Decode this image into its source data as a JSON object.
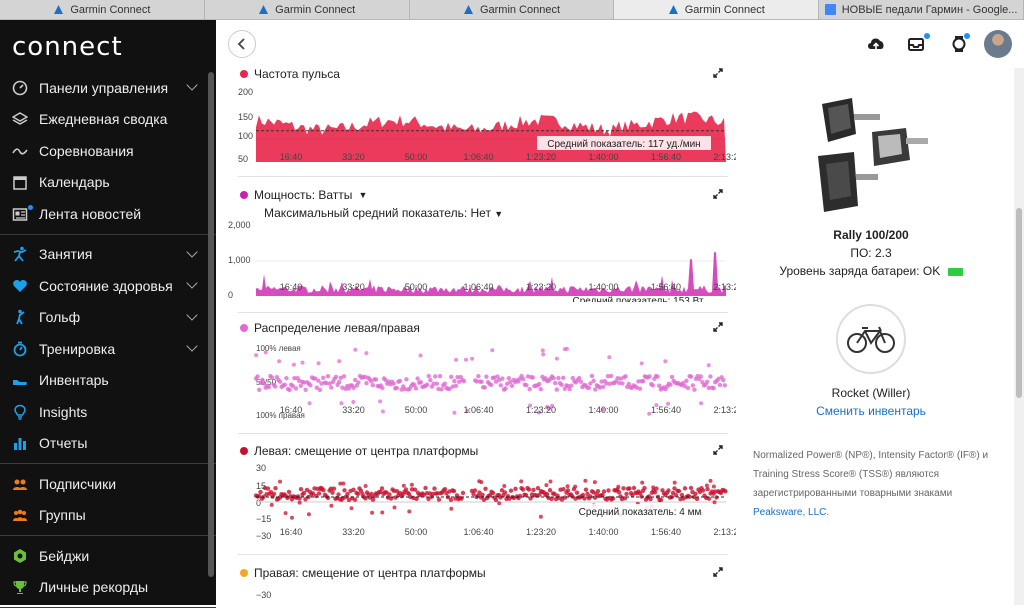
{
  "browser": {
    "tabs": [
      {
        "label": "Garmin Connect",
        "active": false,
        "icon": "garmin-triangle-icon"
      },
      {
        "label": "Garmin Connect",
        "active": false,
        "icon": "garmin-triangle-icon"
      },
      {
        "label": "Garmin Connect",
        "active": false,
        "icon": "garmin-triangle-icon"
      },
      {
        "label": "Garmin Connect",
        "active": true,
        "icon": "garmin-triangle-icon"
      },
      {
        "label": "НОВЫЕ педали Гармин - Google...",
        "active": false,
        "icon": "google-docs-icon"
      }
    ]
  },
  "app": {
    "logo": "connect"
  },
  "sidebar": {
    "groups": [
      [
        {
          "label": "Панели управления",
          "icon": "dashboard-gauge-icon",
          "chevron": true
        },
        {
          "label": "Ежедневная сводка",
          "icon": "layers-icon",
          "chevron": false
        },
        {
          "label": "Соревнования",
          "icon": "challenge-wave-icon",
          "chevron": false
        },
        {
          "label": "Календарь",
          "icon": "calendar-icon",
          "chevron": false
        },
        {
          "label": "Лента новостей",
          "icon": "newsfeed-icon",
          "chevron": false,
          "badge": true
        }
      ],
      [
        {
          "label": "Занятия",
          "icon": "running-person-icon",
          "chevron": true
        },
        {
          "label": "Состояние здоровья",
          "icon": "heart-icon",
          "chevron": true
        },
        {
          "label": "Гольф",
          "icon": "golfer-icon",
          "chevron": true
        },
        {
          "label": "Тренировка",
          "icon": "stopwatch-icon",
          "chevron": true
        },
        {
          "label": "Инвентарь",
          "icon": "shoe-icon",
          "chevron": false
        },
        {
          "label": "Insights",
          "icon": "lightbulb-icon",
          "chevron": false
        },
        {
          "label": "Отчеты",
          "icon": "bar-chart-icon",
          "chevron": false
        }
      ],
      [
        {
          "label": "Подписчики",
          "icon": "connections-icon",
          "chevron": false
        },
        {
          "label": "Группы",
          "icon": "groups-icon",
          "chevron": false
        }
      ],
      [
        {
          "label": "Бейджи",
          "icon": "badge-hexagon-icon",
          "chevron": false
        },
        {
          "label": "Личные рекорды",
          "icon": "trophy-icon",
          "chevron": false
        }
      ]
    ]
  },
  "header": {
    "icons": [
      "upload-cloud-icon",
      "inbox-icon",
      "watch-icon",
      "user-avatar"
    ]
  },
  "charts": {
    "heart_rate": {
      "title": "Частота пульса",
      "color": "#e8264b",
      "y_ticks": [
        "200",
        "150",
        "100",
        "50"
      ],
      "avg_label": "Средний показатель: 117 уд./мин"
    },
    "power": {
      "title": "Мощность: Ватты",
      "subtitle": "Максимальный средний показатель: Нет",
      "color": "#cc1fae",
      "y_ticks": [
        "2,000",
        "1,000",
        "0"
      ],
      "avg_label": "Средний показатель: 153 Вт"
    },
    "balance": {
      "title": "Распределение левая/правая",
      "color": "#e06ad2",
      "y_ticks": [
        "100% левая",
        "50/50",
        "100% правая"
      ]
    },
    "left_pco": {
      "title": "Левая: смещение от центра платформы",
      "color": "#c8102e",
      "y_ticks": [
        "30",
        "15",
        "0",
        "−15",
        "−30"
      ],
      "avg_label": "Средний показатель: 4 мм"
    },
    "right_pco": {
      "title": "Правая: смещение от центра платформы",
      "color": "#f5a623",
      "y_ticks": [
        "−30"
      ]
    },
    "x_ticks": [
      "16:40",
      "33:20",
      "50:00",
      "1:06:40",
      "1:23:20",
      "1:40:00",
      "1:56:40",
      "2:13:20"
    ]
  },
  "device": {
    "name": "Rally 100/200",
    "firmware": "ПО: 2.3",
    "battery": "Уровень заряда батареи: OK",
    "battery_color": "#2ecc40"
  },
  "bike": {
    "name": "Rocket (Willer)",
    "change_link": "Сменить инвентарь"
  },
  "trademark": {
    "text": "Normalized Power® (NP®), Intensity Factor® (IF®) и Training Stress Score® (TSS®) являются зарегистрированными товарными знаками",
    "link": "Peaksware, LLC."
  }
}
